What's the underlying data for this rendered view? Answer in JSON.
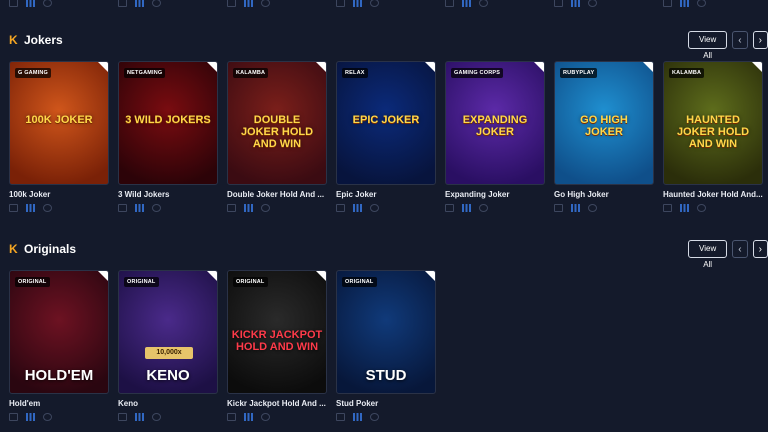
{
  "top_strip": {
    "repeat": 7
  },
  "sections": [
    {
      "id": "jokers",
      "icon": "k-logo-icon",
      "title": "Jokers",
      "view_all": "View All",
      "games": [
        {
          "name": "100k Joker",
          "provider": "G GAMING",
          "art_text": "100K JOKER",
          "bg": "#d0561b",
          "bg2": "#7a2107"
        },
        {
          "name": "3 Wild Jokers",
          "provider": "NETGAMING",
          "art_text": "3 WILD JOKERS",
          "bg": "#7a0c10",
          "bg2": "#2c0308"
        },
        {
          "name": "Double Joker Hold And ...",
          "provider": "KALAMBA",
          "art_text": "DOUBLE JOKER HOLD AND WIN",
          "bg": "#7b1f1a",
          "bg2": "#3b0b12"
        },
        {
          "name": "Epic Joker",
          "provider": "RELAX",
          "art_text": "EPIC JOKER",
          "bg": "#0b2a7a",
          "bg2": "#07143d"
        },
        {
          "name": "Expanding Joker",
          "provider": "GAMING CORPS",
          "art_text": "EXPANDING JOKER",
          "bg": "#5c2aa8",
          "bg2": "#2a0f63"
        },
        {
          "name": "Go High Joker",
          "provider": "RUBYPLAY",
          "art_text": "GO HIGH JOKER",
          "bg": "#1f8fd0",
          "bg2": "#0f4f8a"
        },
        {
          "name": "Haunted Joker Hold And...",
          "provider": "KALAMBA",
          "art_text": "HAUNTED JOKER HOLD AND WIN",
          "bg": "#5e6d1c",
          "bg2": "#2b2e0a"
        }
      ]
    },
    {
      "id": "originals",
      "icon": "k-logo-icon",
      "title": "Originals",
      "view_all": "View All",
      "games": [
        {
          "name": "Hold'em",
          "provider": "ORIGINAL",
          "art_text": "HOLD'EM",
          "bg": "#6d1222",
          "bg2": "#2a0610"
        },
        {
          "name": "Keno",
          "provider": "ORIGINAL",
          "art_text": "KENO",
          "bg": "#4a2a8a",
          "bg2": "#1d1045"
        },
        {
          "name": "Kickr Jackpot Hold And ...",
          "provider": "ORIGINAL",
          "art_text": "KICKR JACKPOT HOLD AND WIN",
          "bg": "#2a2a2a",
          "bg2": "#0c0c0c"
        },
        {
          "name": "Stud Poker",
          "provider": "ORIGINAL",
          "art_text": "STUD",
          "bg": "#103a7a",
          "bg2": "#07173a"
        }
      ]
    }
  ],
  "keno_banner": "10,000x",
  "colors": {
    "background": "#141a2b",
    "accent": "#f5a623",
    "icon_blue": "#3b82f6"
  }
}
